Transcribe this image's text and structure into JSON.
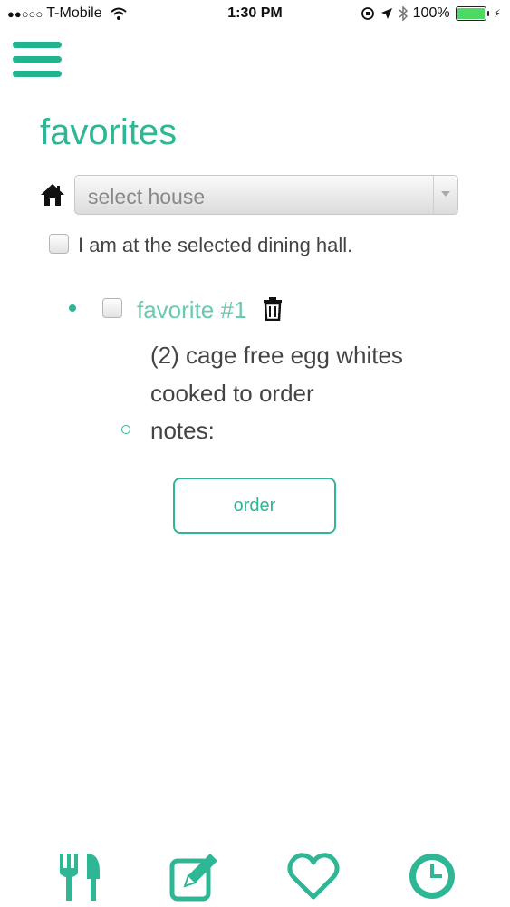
{
  "status_bar": {
    "signal": "●●○○○",
    "carrier": "T-Mobile",
    "time": "1:30 PM",
    "battery": "100%"
  },
  "page": {
    "title": "favorites"
  },
  "house_select": {
    "value": "select house"
  },
  "at_hall_label": "I am at the selected dining hall.",
  "favorite": {
    "label": "favorite #1",
    "line1": "(2) cage free egg whites",
    "line2": "cooked to order",
    "notes_label": "notes:"
  },
  "order_button": "order",
  "accent_color": "#2fb795",
  "icons": {
    "menu": "hamburger-icon",
    "home": "home-icon",
    "trash": "trash-icon",
    "tabs": [
      "utensils-icon",
      "edit-icon",
      "heart-icon",
      "clock-icon"
    ]
  }
}
